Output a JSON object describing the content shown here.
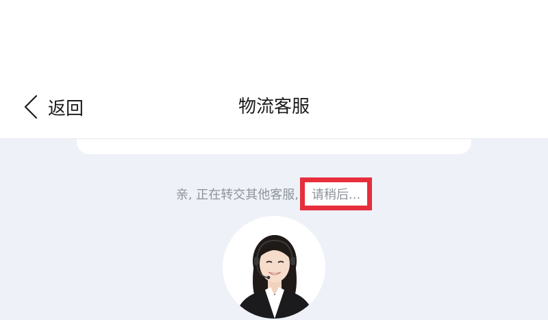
{
  "nav": {
    "back_label": "返回",
    "title": "物流客服"
  },
  "chat": {
    "system_message_prefix": "亲, 正在转交其他客服,",
    "system_message_highlight": "请稍后..."
  },
  "agent": {
    "avatar_icon": "customer-service-agent-avatar"
  },
  "colors": {
    "highlight_border": "#e62e3c",
    "chat_background": "#eef1f8",
    "system_text": "#8e929a"
  }
}
